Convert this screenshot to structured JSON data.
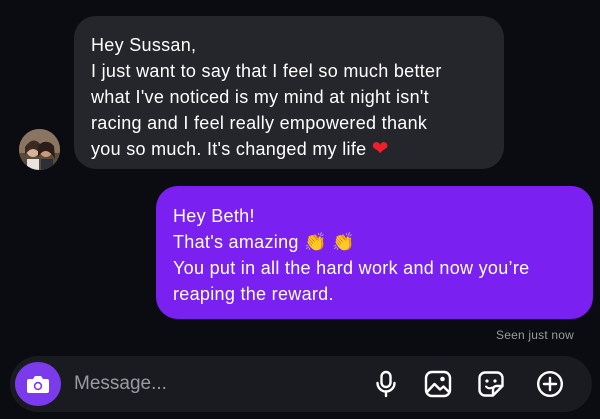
{
  "received_message": {
    "lines": [
      "Hey Sussan,",
      "I just want to say that I feel so much better",
      "what I've noticed is my mind at night isn't",
      "racing and I feel really empowered thank",
      "you so much. It's changed my life"
    ],
    "emoji": "❤",
    "emoji_name": "red-heart"
  },
  "sent_message": {
    "lines": [
      "Hey Beth!",
      "That's amazing",
      "You put in all the hard work and now you’re",
      "reaping the reward."
    ],
    "emoji": "👏 👏",
    "emoji_name": "clapping-hands"
  },
  "status": {
    "seen": "Seen just now"
  },
  "composer": {
    "placeholder": "Message...",
    "icons": [
      "camera-icon",
      "microphone-icon",
      "gallery-icon",
      "sticker-icon",
      "add-icon"
    ]
  },
  "colors": {
    "background": "#0b0c12",
    "received_bubble": "#25262c",
    "sent_bubble": "#7a21f2",
    "camera_button": "#7c3aed"
  }
}
